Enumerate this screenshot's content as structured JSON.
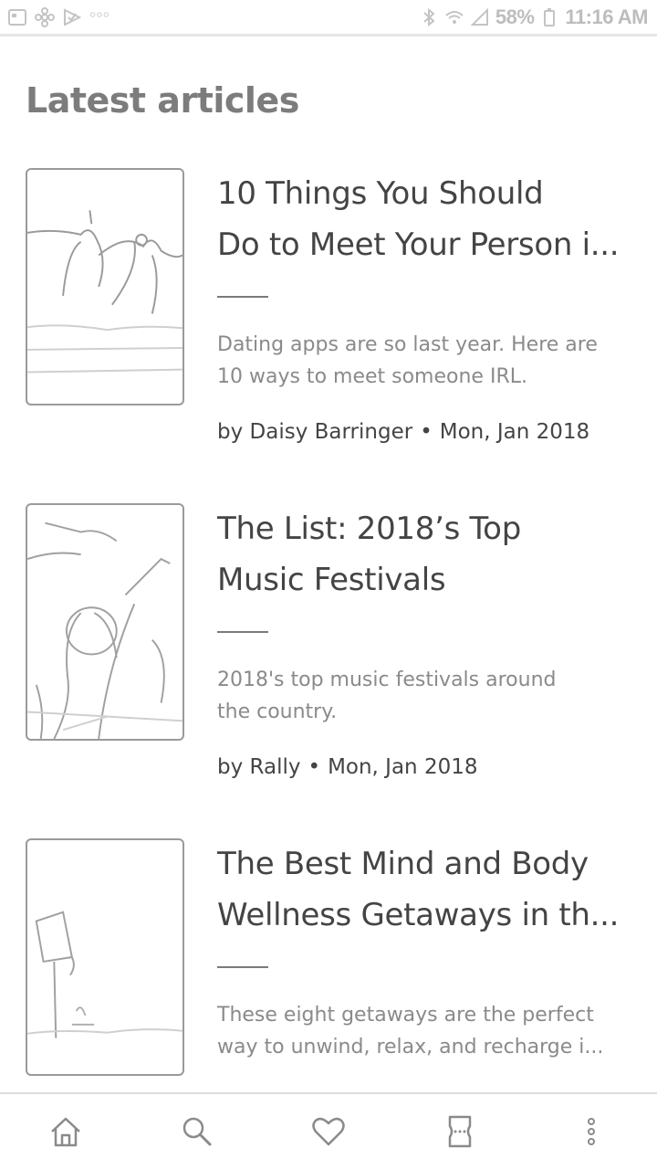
{
  "status_bar": {
    "battery": "58%",
    "time": "11:16 AM",
    "icons": [
      "gallery-icon",
      "pinwheel-icon",
      "check-icon",
      "more-dots-icon",
      "bluetooth-icon",
      "wifi-icon",
      "signal-icon",
      "battery-icon"
    ]
  },
  "section_title": "Latest articles",
  "articles": [
    {
      "title_lines": [
        "10 Things You Should",
        "Do to Meet Your Person i..."
      ],
      "summary_lines": [
        "Dating apps are so last year. Here are",
        "10 ways to meet someone IRL."
      ],
      "author": "by Daisy Barringer",
      "date": "Mon, Jan 2018",
      "thumb": "people-jumping-beach-image"
    },
    {
      "title_lines": [
        "The List: 2018’s Top",
        "Music Festivals"
      ],
      "summary_lines": [
        "2018's top music festivals around",
        "the country."
      ],
      "author": "by Rally",
      "date": "Mon, Jan 2018",
      "thumb": "festival-crowd-image"
    },
    {
      "title_lines": [
        "The Best Mind and Body",
        "Wellness Getaways in th..."
      ],
      "summary_lines": [
        "These eight getaways are the perfect",
        "way to unwind, relax, and recharge i..."
      ],
      "author": "",
      "date": "",
      "thumb": "wellness-yoga-image"
    }
  ],
  "bottom_nav": [
    "home-icon",
    "search-icon",
    "heart-icon",
    "ticket-icon",
    "more-vertical-icon"
  ],
  "colors": {
    "title": "#7c7c7c",
    "text": "#444444",
    "muted": "#8a8a8a",
    "border": "#9a9a9a"
  }
}
